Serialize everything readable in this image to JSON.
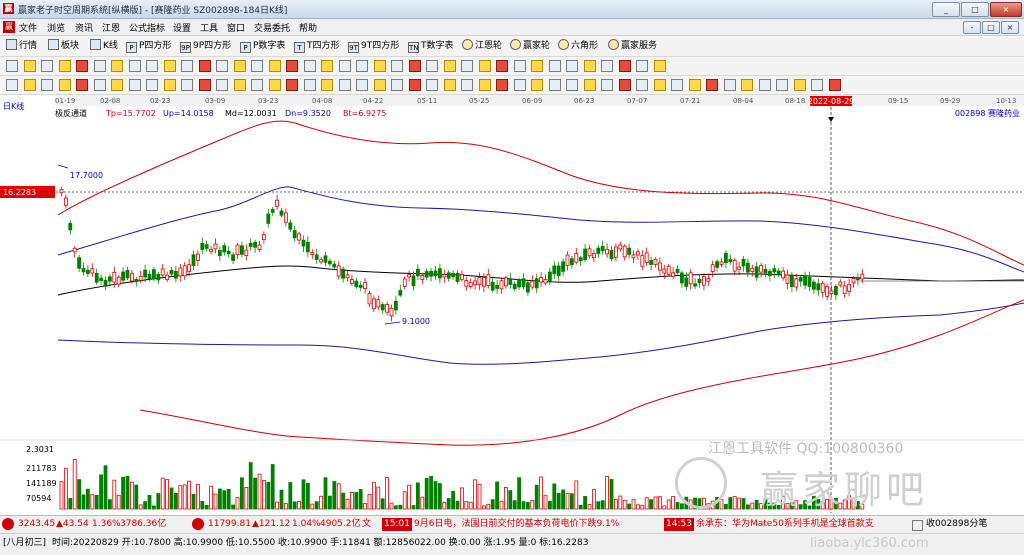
{
  "window": {
    "title": "赢家老子时空周期系统[纵横版] - [赛隆药业  SZ002898-184日K线]",
    "app_icon": "赢",
    "buttons": [
      "_",
      "□",
      "×"
    ],
    "sub_buttons": [
      "-",
      "□",
      "×"
    ]
  },
  "menu": {
    "logo": "赢",
    "items": [
      "文件",
      "浏览",
      "资讯",
      "江恩",
      "公式指标",
      "设置",
      "工具",
      "窗口",
      "交易委托",
      "帮助"
    ]
  },
  "toolbar": {
    "items": [
      "行情",
      "板块",
      "K线",
      "P四方形",
      "9P四方形",
      "P数字表",
      "T四方形",
      "9T四方形",
      "T数字表",
      "江恩轮",
      "赢家轮",
      "六角形",
      "赢家服务"
    ],
    "icon_letters": [
      "",
      "",
      "",
      "P",
      "9P",
      "P",
      "T",
      "9T",
      "TN",
      "",
      "",
      "",
      ""
    ]
  },
  "chart": {
    "period_label": "日K线",
    "indicator_name": "极反通道",
    "params": {
      "tp": "Tp=15.7702",
      "up": "Up=14.0158",
      "md": "Md=12.0031",
      "dn": "Dn=9.3520",
      "bt": "Bt=6.9275"
    },
    "stock_label": "002898  赛隆药业",
    "price_tag": "16.2283",
    "high_label": "17.7000",
    "low_label": "9.1000",
    "cursor_date": "2022-08-29",
    "volume_axis": [
      "2.3031",
      "211783",
      "141189",
      "70594"
    ],
    "date_ticks": [
      "01-19",
      "02-08",
      "02-23",
      "03-09",
      "03-23",
      "04-08",
      "04-22",
      "05-11",
      "05-25",
      "06-09",
      "06-23",
      "07-07",
      "07-21",
      "08-04",
      "08-18",
      "09-15",
      "09-29",
      "10-13"
    ]
  },
  "watermark": {
    "line1": "江恩工具软件  QQ:100800360",
    "line2": "赢家聊吧",
    "line3": "liaoba.ylc360.com"
  },
  "status": {
    "sh_index": "3243.45",
    "sh_change": "▲43.54",
    "sh_pct": "1.36%",
    "sh_amount": "3786.36亿",
    "sz_index": "11799.81",
    "sz_change": "▲121.12",
    "sz_pct": "1.04%",
    "sz_amount": "4905.2亿",
    "news_tag": "文",
    "news_time1": "15:01",
    "news1": "9月6日电，法国日前交付的基本负荷电价下跌9.1%",
    "news_time2": "14:53",
    "news2": "余承东：华为Mate50系列手机是全球首款支",
    "right_info": "收002898分笔"
  },
  "status2": {
    "lunar": "[八月初三]",
    "info": "时间:20220829 开:10.7800 高:10.9900 低:10.5500 收:10.9900 手:11841 额:12856022.00 换:0.00 涨:1.95 量:0 标:16.2283"
  }
}
